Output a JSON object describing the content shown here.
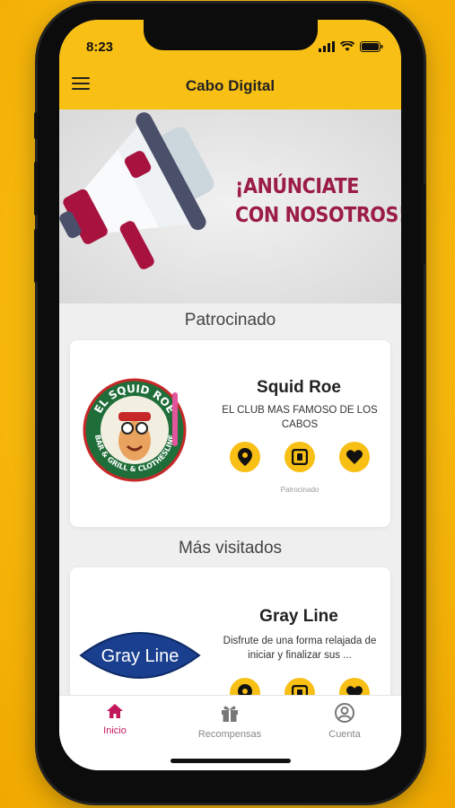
{
  "status_bar": {
    "time": "8:23"
  },
  "app_bar": {
    "title": "Cabo Digital"
  },
  "banner": {
    "line1": "¡ANÚNCIATE",
    "line2": "CON NOSOTROS!"
  },
  "sections": {
    "sponsored_title": "Patrocinado",
    "most_visited_title": "Más visitados"
  },
  "sponsored_card": {
    "name": "Squid Roe",
    "description": "EL CLUB MAS FAMOSO DE LOS CABOS",
    "tag": "Patrocinado",
    "logo_text_top": "EL SQUID ROE",
    "logo_text_bottom": "BAR & GRILL & CLOTHESLINE"
  },
  "visited_card": {
    "name": "Gray Line",
    "description": "Disfrute de una forma relajada de iniciar y finalizar sus ...",
    "logo_text": "Gray Line"
  },
  "tabs": [
    {
      "label": "Inicio",
      "icon": "home-icon",
      "active": true
    },
    {
      "label": "Recompensas",
      "icon": "gift-icon",
      "active": false
    },
    {
      "label": "Cuenta",
      "icon": "account-icon",
      "active": false
    }
  ],
  "colors": {
    "accent": "#f8bf14",
    "active_tab": "#c2185b",
    "banner_text": "#9b1c47"
  }
}
